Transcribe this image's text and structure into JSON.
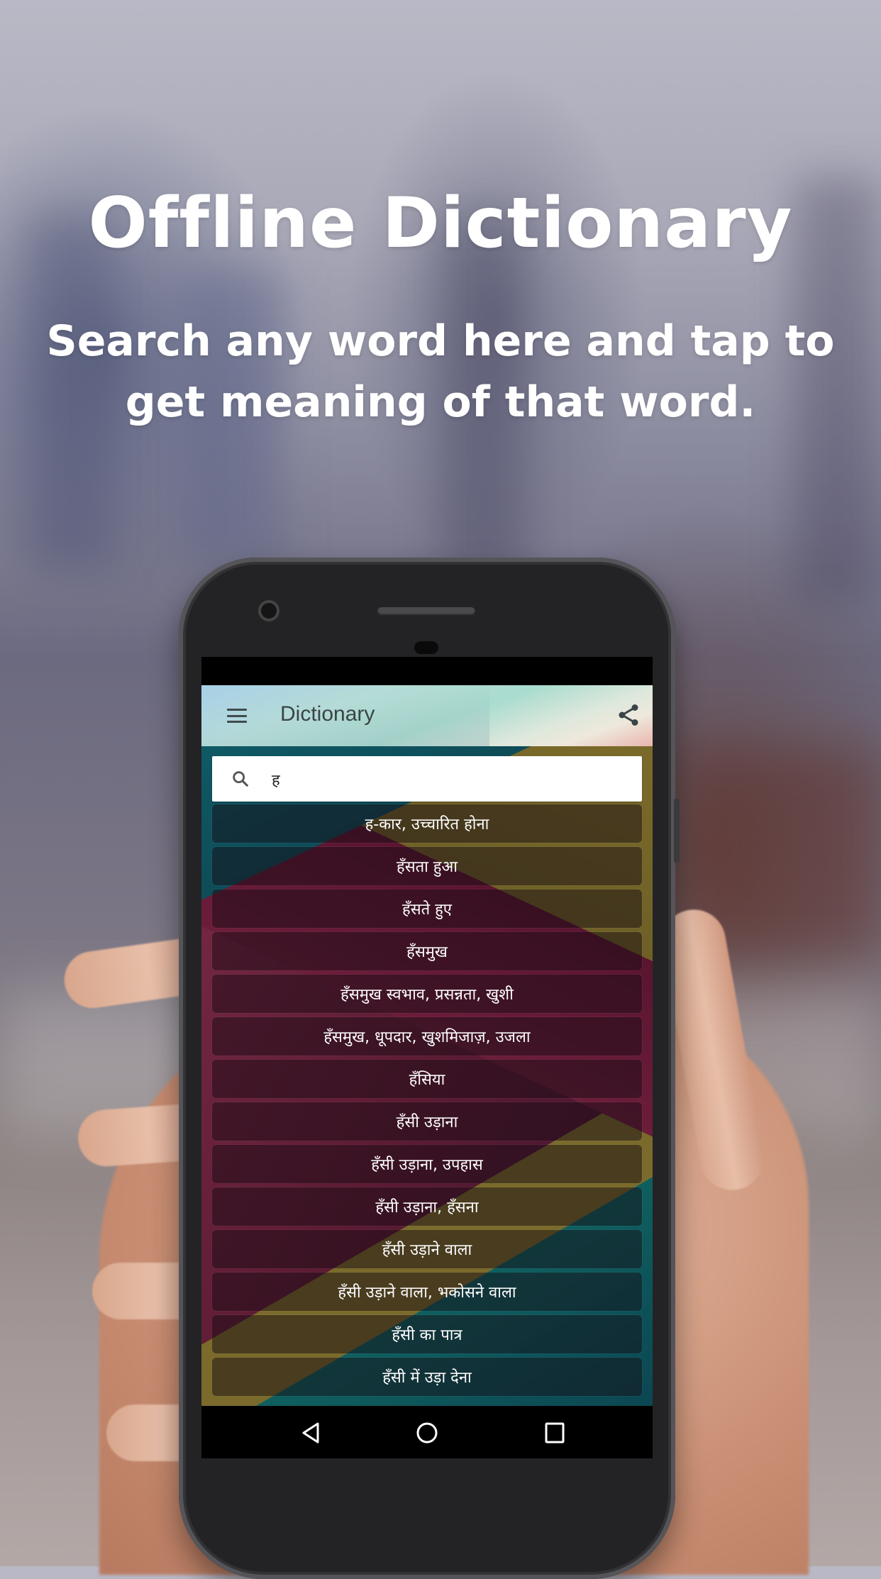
{
  "promo": {
    "title": "Offline Dictionary",
    "subtitle": "Search any word here and tap to get meaning of that word."
  },
  "app": {
    "toolbar": {
      "title": "Dictionary",
      "menu_icon": "hamburger-menu-icon",
      "share_icon": "share-icon"
    },
    "search": {
      "icon": "search-icon",
      "value": "ह",
      "placeholder": ""
    },
    "results": [
      "ह-कार, उच्चारित होना",
      "हँसता हुआ",
      "हँसते हुए",
      "हँसमुख",
      "हँसमुख स्वभाव, प्रसन्नता, खुशी",
      "हँसमुख, धूपदार, खुशमिजाज़, उजला",
      "हँसिया",
      "हँसी उड़ाना",
      "हँसी उड़ाना, उपहास",
      "हँसी उड़ाना, हँसना",
      "हँसी उड़ाने वाला",
      "हँसी उड़ाने वाला, भकोसने वाला",
      "हँसी का पात्र",
      "हँसी में उड़ा देना"
    ],
    "navbar": {
      "back_icon": "back-triangle-icon",
      "home_icon": "home-circle-icon",
      "recents_icon": "recents-square-icon"
    }
  },
  "colors": {
    "headline_text": "#ffffff",
    "toolbar_text": "#3a4446",
    "result_text": "#ffffff",
    "search_bg": "#ffffff"
  }
}
